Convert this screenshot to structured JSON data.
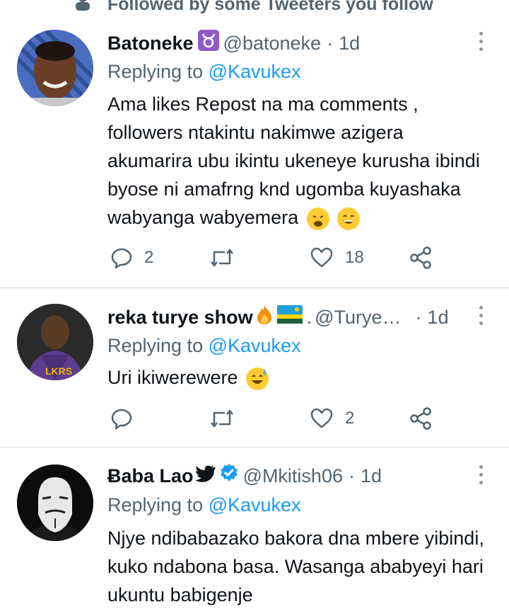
{
  "banner": {
    "text": "Followed by some Tweeters you follow",
    "icon": "person-icon"
  },
  "tweets": [
    {
      "name": "Batoneke",
      "handle": "@batoneke",
      "dot": "·",
      "time": "1d",
      "replying_prefix": "Replying to",
      "mention": "@Kavukex",
      "body": "Ama likes Repost na ma comments , followers ntakintu nakimwe azigera akumarira ubu ikintu ukeneye kurusha ibindi byose ni amafrng knd ugomba kuyashaka wabyanga wabyemera",
      "replies": "2",
      "retweets": "",
      "likes": "18",
      "avatar_color": "#3b5fa8",
      "badge": "taurus-icon"
    },
    {
      "name": "reka turye show",
      "handle": "@Turye…",
      "dot": "·",
      "time": "1d",
      "replying_prefix": "Replying to",
      "mention": "@Kavukex",
      "body": "Uri ikiwerewere",
      "replies": "",
      "retweets": "",
      "likes": "2",
      "avatar_color": "#5a3d82",
      "badge": "fire-emoji rwanda-flag"
    },
    {
      "name": "Ƀaba Lao",
      "handle": "@Mkitish06",
      "dot": "·",
      "time": "1d",
      "replying_prefix": "Replying to",
      "mention": "@Kavukex",
      "body": "Njye ndibabazako bakora dna mbere yibindi, kuko ndabona basa. Wasanga ababyeyi hari ukuntu babigenje",
      "avatar_color": "#111111",
      "badge": "bird-icon verified-icon"
    }
  ],
  "colors": {
    "accent": "#1d9bf0",
    "secondary": "#536471",
    "divider": "#cfd9de"
  }
}
